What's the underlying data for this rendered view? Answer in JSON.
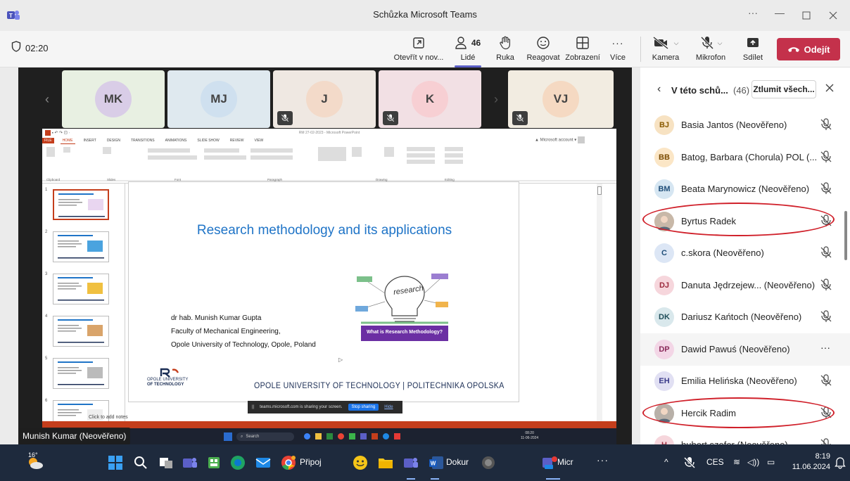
{
  "window": {
    "title": "Schůzka Microsoft Teams",
    "more": "···"
  },
  "meeting": {
    "timer": "02:20"
  },
  "toolbar": {
    "open_new": "Otevřít v nov...",
    "people": "Lidé",
    "people_count": "46",
    "raise": "Ruka",
    "react": "Reagovat",
    "view": "Zobrazení",
    "more": "Více",
    "camera": "Kamera",
    "mic": "Mikrofon",
    "share": "Sdílet",
    "leave": "Odejít"
  },
  "tiles": [
    {
      "initials": "MK",
      "bg": "#e8f0e2",
      "avbg": "#d9cde7",
      "muted": false
    },
    {
      "initials": "MJ",
      "bg": "#dfe9ef",
      "avbg": "#cfe0ef",
      "muted": false
    },
    {
      "initials": "J",
      "bg": "#efe8e2",
      "avbg": "#f3dac9",
      "muted": true
    },
    {
      "initials": "K",
      "bg": "#f2e0e4",
      "avbg": "#f7cfd3",
      "muted": true
    },
    {
      "initials": "VJ",
      "bg": "#f2ece1",
      "avbg": "#f5d9c2",
      "muted": true
    }
  ],
  "ppt": {
    "doc_title": "RM 27-02-2023 - Microsoft PowerPoint",
    "account": "Microsoft account",
    "tabs": [
      "FILE",
      "HOME",
      "INSERT",
      "DESIGN",
      "TRANSITIONS",
      "ANIMATIONS",
      "SLIDE SHOW",
      "REVIEW",
      "VIEW"
    ],
    "groups": [
      "Clipboard",
      "Slides",
      "Font",
      "Paragraph",
      "Drawing",
      "Editing"
    ],
    "slide_title": "Research methodology and its applications",
    "author": "dr hab. Munish Kumar Gupta",
    "faculty": "Faculty of Mechanical Engineering,",
    "university": "Opole University of Technology, Opole, Poland",
    "image_word": "research",
    "image_caption": "What is Research Methodology?",
    "logo_line1": "OPOLE UNIVERSITY",
    "logo_line2": "OF TECHNOLOGY",
    "footer": "OPOLE UNIVERSITY OF TECHNOLOGY | POLITECHNIKA OPOLSKA",
    "notes": "Click to add notes",
    "thumb_numbers": [
      "1",
      "2",
      "3",
      "4",
      "5",
      "6"
    ],
    "share_text": "teams.microsoft.com is sharing your screen.",
    "stop_sharing": "Stop sharing",
    "hide": "Hide",
    "search": "Search",
    "time": "08:20",
    "date": "11-06-2024"
  },
  "presenter": "Munish Kumar (Neověřeno)",
  "panel": {
    "title": "V této schů...",
    "count": "(46)",
    "mute_all": "Ztlumit všech...",
    "participants": [
      {
        "initials": "BJ",
        "name": "Basia Jantos (Neověřeno)",
        "avbg": "#f7e2c2",
        "avfg": "#8a5a00",
        "photo": false,
        "more": false
      },
      {
        "initials": "BB",
        "name": "Batog, Barbara (Chorula) POL (...",
        "avbg": "#fbe6c6",
        "avfg": "#7a4a00",
        "photo": false,
        "more": false
      },
      {
        "initials": "BM",
        "name": "Beata Marynowicz (Neověřeno)",
        "avbg": "#d6e6f2",
        "avfg": "#1f4e79",
        "photo": false,
        "more": false
      },
      {
        "initials": "",
        "name": "Byrtus Radek",
        "avbg": "#c8b8a8",
        "avfg": "#333",
        "photo": true,
        "more": false
      },
      {
        "initials": "C",
        "name": "c.skora (Neověřeno)",
        "avbg": "#dce6f5",
        "avfg": "#1f4e79",
        "photo": false,
        "more": false
      },
      {
        "initials": "DJ",
        "name": "Danuta Jędrzejew... (Neověřeno)",
        "avbg": "#f6d6dc",
        "avfg": "#9c2a3d",
        "photo": false,
        "more": false
      },
      {
        "initials": "DK",
        "name": "Dariusz Kańtoch (Neověřeno)",
        "avbg": "#d9e8ec",
        "avfg": "#1f4e5a",
        "photo": false,
        "more": false
      },
      {
        "initials": "DP",
        "name": "Dawid Pawuś (Neověřeno)",
        "avbg": "#f3d6e6",
        "avfg": "#8a2a5a",
        "photo": false,
        "more": true
      },
      {
        "initials": "EH",
        "name": "Emilia Helińska (Neověřeno)",
        "avbg": "#e1e0f3",
        "avfg": "#3a3a8a",
        "photo": false,
        "more": false
      },
      {
        "initials": "",
        "name": "Hercik Radim",
        "avbg": "#b8b0a8",
        "avfg": "#333",
        "photo": true,
        "more": false
      },
      {
        "initials": "H",
        "name": "hubert.szefer (Neověřeno)",
        "avbg": "#f6d6dc",
        "avfg": "#9c2a3d",
        "photo": false,
        "more": false
      }
    ]
  },
  "taskbar": {
    "weather": "16°",
    "pripoj": "Připoj",
    "dokument": "Dokur",
    "teams": "Micr",
    "more": "···",
    "lang": "CES",
    "time": "8:19",
    "date": "11.06.2024"
  },
  "colors": {
    "accent": "#5b5fc7",
    "leave": "#c4314b",
    "ppt_orange": "#c43e1c",
    "circle": "#d0202a"
  }
}
